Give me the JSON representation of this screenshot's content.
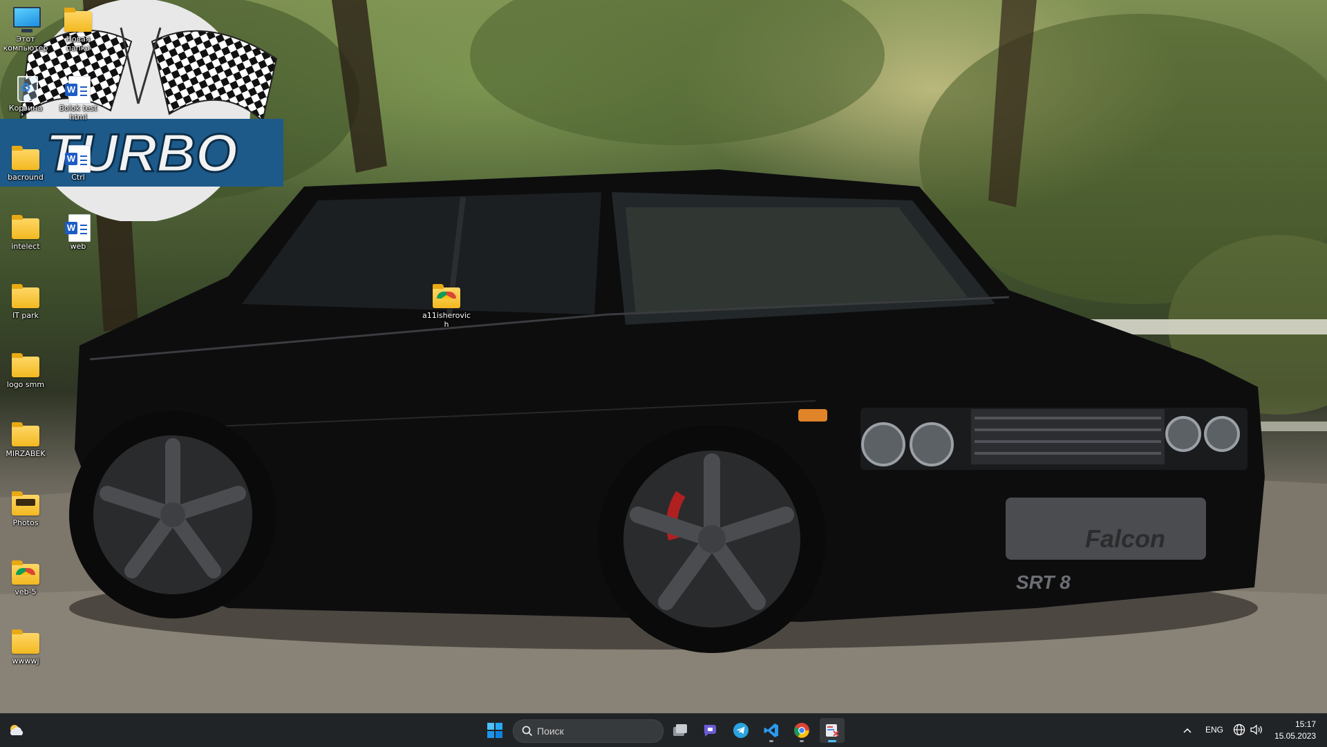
{
  "desktop": {
    "icons": [
      {
        "label": "Этот компьютер",
        "type": "this-pc"
      },
      {
        "label": "Новая папка",
        "type": "folder"
      },
      {
        "label": "Корзина",
        "type": "recycle-bin"
      },
      {
        "label": "Bolok test html",
        "type": "word-doc"
      },
      {
        "label": "bacround",
        "type": "folder"
      },
      {
        "label": "Ctrl",
        "type": "word-doc"
      },
      {
        "label": "intelect",
        "type": "folder"
      },
      {
        "label": "web",
        "type": "word-doc"
      },
      {
        "label": "IT park",
        "type": "folder"
      },
      {
        "label": "logo smm",
        "type": "folder"
      },
      {
        "label": "MIRZABEK",
        "type": "folder"
      },
      {
        "label": "Photos",
        "type": "folder-photos"
      },
      {
        "label": "veb-5",
        "type": "folder-chrome"
      },
      {
        "label": "wwwwj",
        "type": "folder"
      },
      {
        "label": "a11isherovich",
        "type": "folder-chrome"
      }
    ]
  },
  "wallpaper": {
    "logo_text": "TURBO",
    "car_bumper_text": "Falcon",
    "car_badge_text": "SRT 8"
  },
  "taskbar": {
    "widgets_icon": "weather-widget-icon",
    "start_icon": "windows-start-icon",
    "search_placeholder": "Поиск",
    "pinned": [
      {
        "name": "task-view",
        "icon": "task-view-icon"
      },
      {
        "name": "teams-chat",
        "icon": "teams-chat-icon"
      },
      {
        "name": "telegram",
        "icon": "telegram-icon"
      },
      {
        "name": "vscode",
        "icon": "vscode-icon",
        "running": true
      },
      {
        "name": "chrome",
        "icon": "chrome-icon",
        "running": true
      },
      {
        "name": "snipping-tool",
        "icon": "snipping-tool-icon",
        "running": true,
        "active": true
      }
    ],
    "tray": {
      "chevron_icon": "chevron-up-icon",
      "language": "ENG",
      "network_icon": "globe-network-icon",
      "volume_icon": "speaker-icon"
    },
    "clock": {
      "time": "15:17",
      "date": "15.05.2023"
    }
  },
  "colors": {
    "taskbar": "#202428",
    "accent": "#4cc2ff",
    "folder": "#f2b820",
    "turbo_banner": "#1d5a8a"
  }
}
